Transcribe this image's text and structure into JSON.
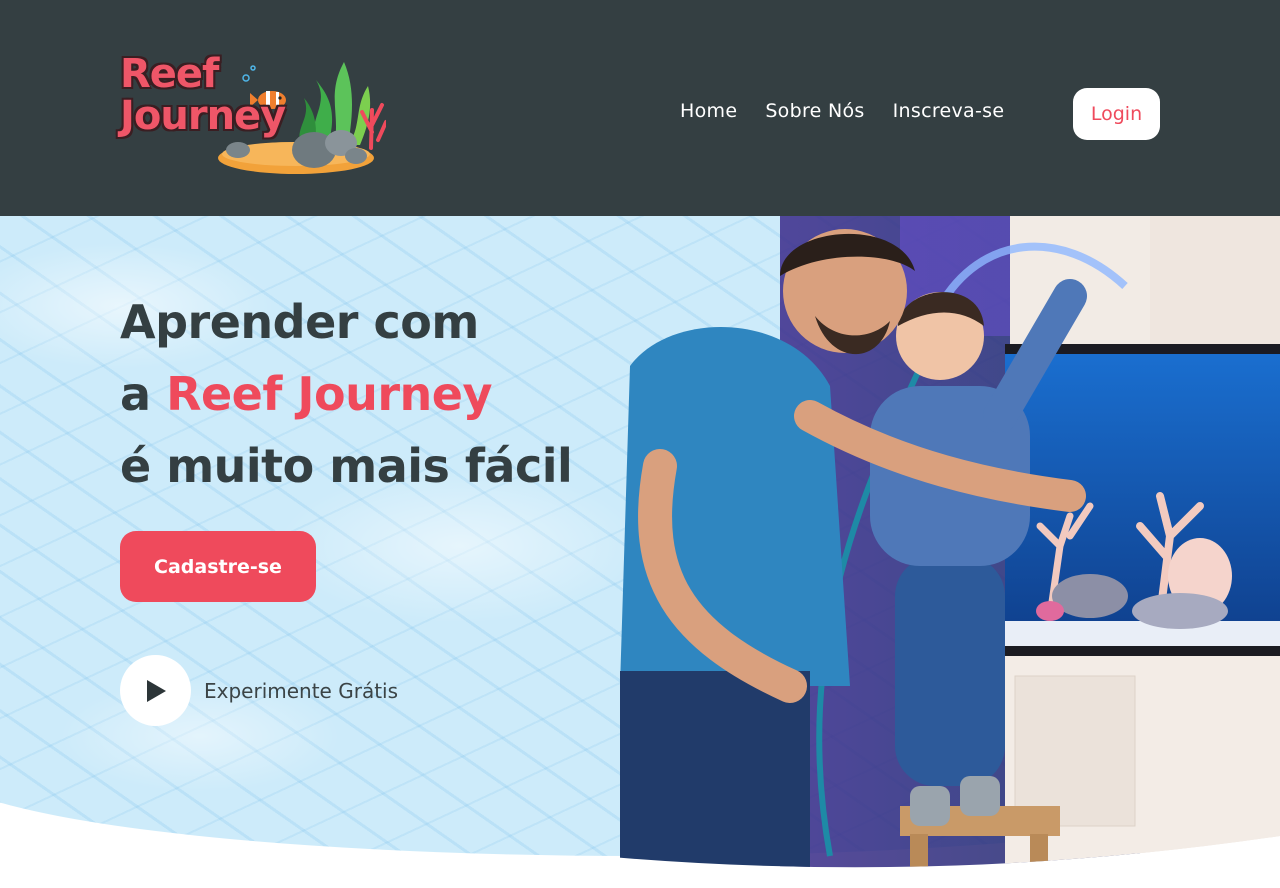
{
  "logo": {
    "line1": "Reef",
    "line2": "Journey"
  },
  "nav": {
    "items": [
      {
        "label": "Home"
      },
      {
        "label": "Sobre Nós"
      },
      {
        "label": "Inscreva-se"
      }
    ],
    "login_label": "Login"
  },
  "hero": {
    "headline": {
      "line1": "Aprender com",
      "line2_prefix": "a ",
      "line2_accent": "Reef Journey",
      "line3": "é muito mais fácil"
    },
    "cta_label": "Cadastre-se",
    "trial_label": "Experimente Grátis"
  },
  "colors": {
    "header_bg": "#343f42",
    "accent": "#ef4a5c",
    "hero_bg": "#cdebfa",
    "text_dark": "#343f42"
  },
  "icons": {
    "play": "play-icon"
  }
}
